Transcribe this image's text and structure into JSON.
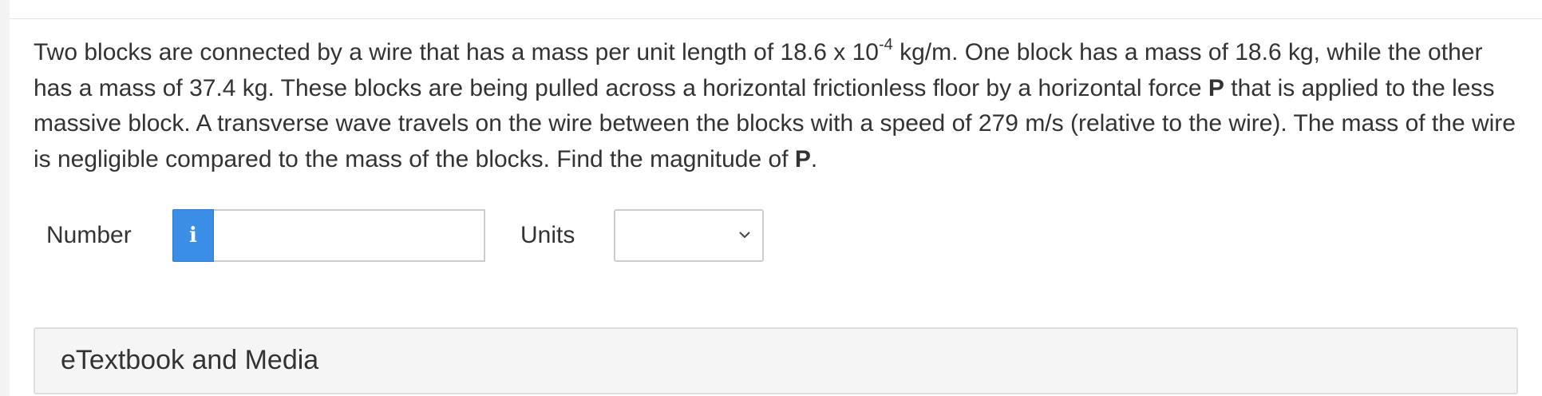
{
  "question": {
    "part1": "Two blocks are connected by a wire that has a mass per unit length of 18.6 x 10",
    "exponent": "-4",
    "part2": " kg/m. One block has a mass of 18.6 kg, while the other has a mass of 37.4 kg. These blocks are being pulled across a horizontal frictionless floor by a horizontal force ",
    "force_symbol": "P",
    "part3": " that is applied to the less massive block. A transverse wave travels on the wire between the blocks with a speed of 279 m/s (relative to the wire). The mass of the wire is negligible compared to the mass of the blocks. Find the magnitude of ",
    "force_symbol_2": "P",
    "part4": "."
  },
  "answer": {
    "number_label": "Number",
    "info_icon_glyph": "i",
    "number_value": "",
    "units_label": "Units",
    "units_selected": ""
  },
  "etextbook": {
    "title": "eTextbook and Media"
  },
  "colors": {
    "info_button": "#3a8ee6",
    "text": "#333333",
    "panel_bg": "#f5f5f5"
  }
}
